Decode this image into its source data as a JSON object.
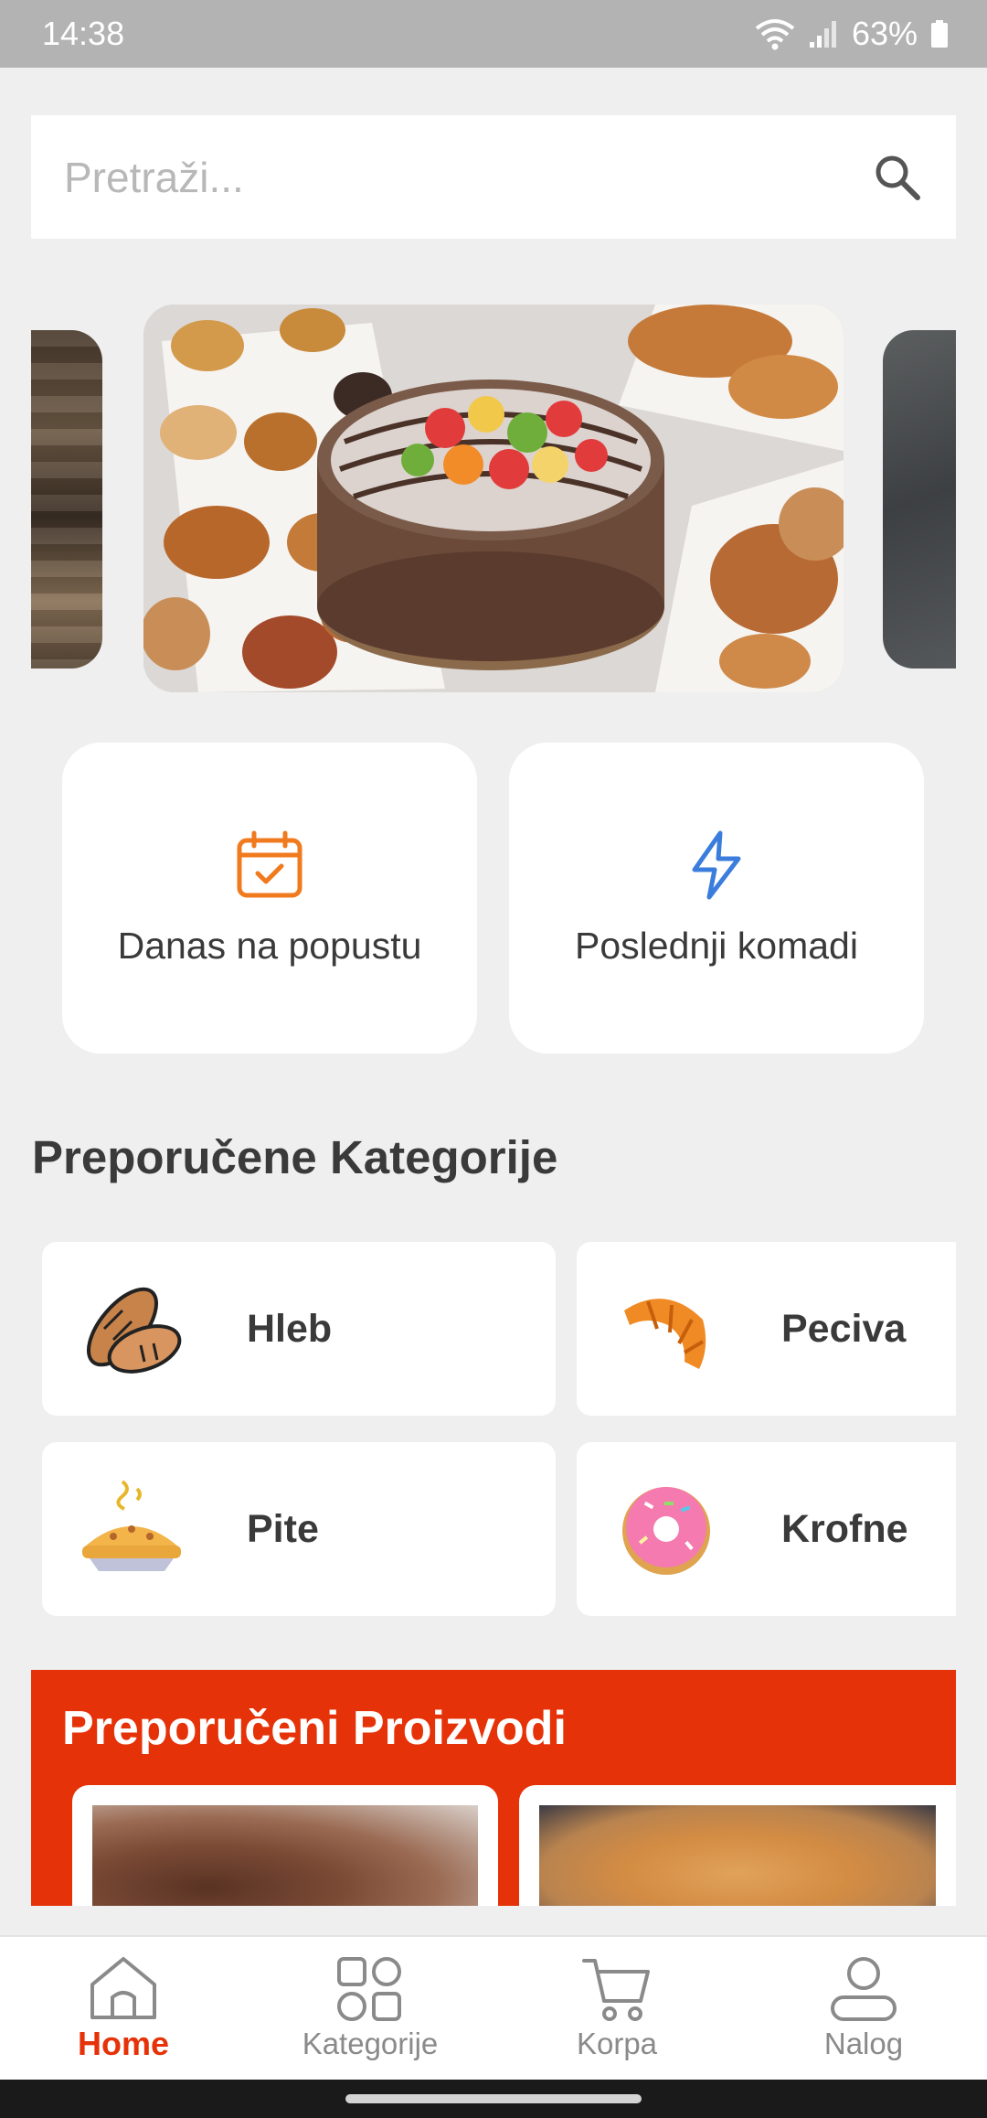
{
  "status_bar": {
    "time": "14:38",
    "battery": "63%",
    "icons": [
      "wifi-icon",
      "signal-icon",
      "battery-icon"
    ]
  },
  "search": {
    "placeholder": "Pretraži...",
    "value": "",
    "icon": "search-icon"
  },
  "carousel": {
    "slides": [
      "bakery-shelf-image",
      "cake-and-pastries-image",
      "dark-stone-image"
    ],
    "active_index": 1
  },
  "quick_actions": [
    {
      "label": "Danas na popustu",
      "icon": "calendar-check-icon",
      "color": "#f07a1e"
    },
    {
      "label": "Poslednji komadi",
      "icon": "lightning-icon",
      "color": "#3b7ddd"
    }
  ],
  "categories_section": {
    "title": "Preporučene Kategorije",
    "items": [
      {
        "label": "Hleb",
        "icon": "bread-icon"
      },
      {
        "label": "Peciva",
        "icon": "croissant-icon"
      },
      {
        "label": "Pite",
        "icon": "pie-icon"
      },
      {
        "label": "Krofne",
        "icon": "donut-icon"
      }
    ]
  },
  "featured_section": {
    "title": "Preporučeni Proizvodi",
    "background": "#e63208",
    "products": [
      {
        "image": "chocolate-cake-image"
      },
      {
        "image": "danish-pastry-image"
      }
    ]
  },
  "bottom_nav": {
    "active_color": "#e63208",
    "items": [
      {
        "label": "Home",
        "icon": "home-icon",
        "active": true
      },
      {
        "label": "Kategorije",
        "icon": "grid-icon",
        "active": false
      },
      {
        "label": "Korpa",
        "icon": "cart-icon",
        "active": false
      },
      {
        "label": "Nalog",
        "icon": "user-icon",
        "active": false
      }
    ]
  }
}
